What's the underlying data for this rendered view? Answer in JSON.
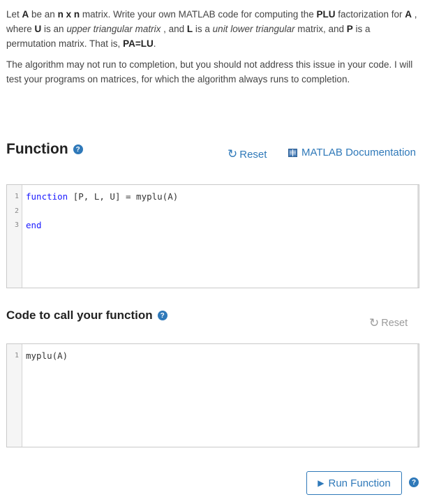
{
  "description": {
    "p1": {
      "t1": "Let ",
      "A": "A",
      "t2": " be an ",
      "nxn": "n x n",
      "t3": " matrix. Write your own MATLAB code for computing the ",
      "PLU": "PLU",
      "t4": " factorization for ",
      "A2": "A",
      "t5": " , where ",
      "U": "U",
      "t6": " is an ",
      "upper": "upper triangular matrix",
      "t7": " , and ",
      "L": "L",
      "t8": " is a ",
      "unit": "unit lower triangular",
      "t9": " matrix, and ",
      "P": "P",
      "t10": " is a permutation matrix. That is, ",
      "eq": "PA=LU",
      "t11": "."
    },
    "p2": "The algorithm may not run to completion, but you should not address this issue in your code. I will test your programs on matrices, for which the algorithm always runs to completion."
  },
  "function_section": {
    "title": "Function",
    "help_icon": "?",
    "reset_label": "Reset",
    "doc_label": "MATLAB Documentation",
    "lines": [
      {
        "num": "1",
        "kw": "function",
        "rest": " [P, L, U] = myplu(A)"
      },
      {
        "num": "2",
        "kw": "",
        "rest": ""
      },
      {
        "num": "3",
        "kw": "end",
        "rest": ""
      }
    ]
  },
  "call_section": {
    "title": "Code to call your function",
    "help_icon": "?",
    "reset_label": "Reset",
    "lines": [
      {
        "num": "1",
        "code": "myplu(A)"
      }
    ]
  },
  "run_label": "Run Function",
  "icons": {
    "reset": "reset-icon",
    "play": "play-icon",
    "book": "book-icon",
    "help": "help-icon"
  },
  "colors": {
    "accent": "#2f79b9",
    "keyword": "#1a1aff",
    "disabled": "#9b9b9b"
  }
}
